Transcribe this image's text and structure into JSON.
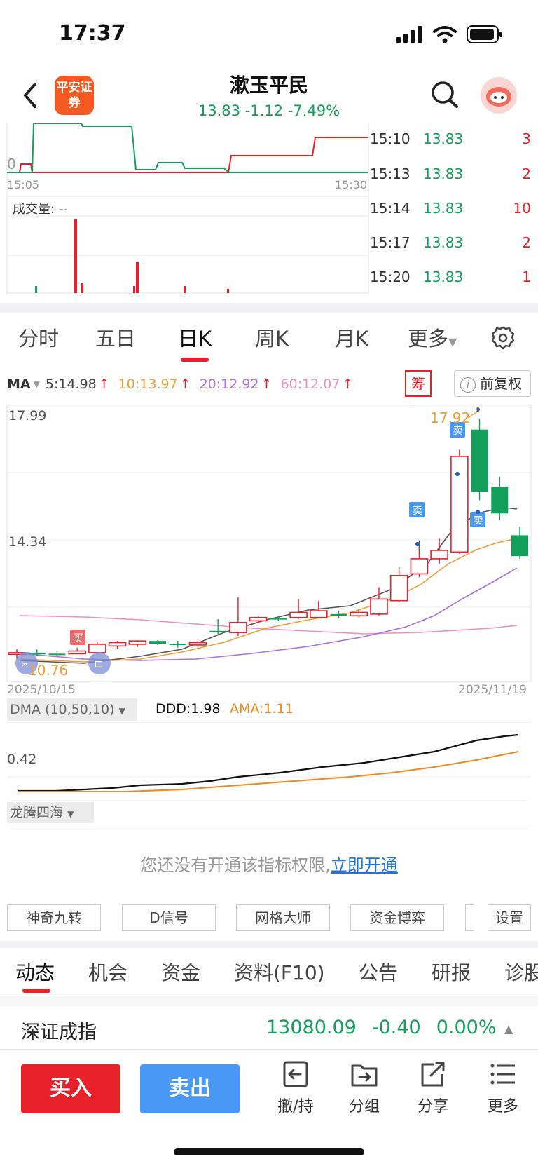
{
  "status": {
    "time": "17:37"
  },
  "header": {
    "broker_logo": "平安证券",
    "stock_name": "漱玉平民",
    "quote": "13.83 -1.12 -7.49%",
    "icons": {
      "back": "back-arrow-icon",
      "search": "search-icon",
      "avatar": "assistant-avatar-icon"
    }
  },
  "intraday": {
    "zero_label": "0",
    "time_start": "15:05",
    "time_end": "15:30",
    "volume_label": "成交量: --",
    "ticks": [
      {
        "time": "15:10",
        "price": "13.83",
        "vol": "3"
      },
      {
        "time": "15:13",
        "price": "13.83",
        "vol": "2"
      },
      {
        "time": "15:14",
        "price": "13.83",
        "vol": "10"
      },
      {
        "time": "15:17",
        "price": "13.83",
        "vol": "2"
      },
      {
        "time": "15:20",
        "price": "13.83",
        "vol": "1"
      }
    ]
  },
  "period_tabs": [
    "分时",
    "五日",
    "日K",
    "周K",
    "月K",
    "更多"
  ],
  "active_period": "日K",
  "ma": {
    "label": "MA",
    "ma5": "5:14.98",
    "ma10": "10:13.97",
    "ma20": "20:12.92",
    "ma60": "60:12.07",
    "chou_label": "筹",
    "fuquan_label": "前复权"
  },
  "kline": {
    "y_high": "17.99",
    "y_mid": "14.34",
    "peak_label": "17.92",
    "low_label": "10.76",
    "date_start": "2025/10/15",
    "date_end": "2025/11/19",
    "buy_marker": "买",
    "sell_marker": "卖"
  },
  "chart_data": {
    "type": "candlestick",
    "x_range": [
      "2025/10/15",
      "2025/11/19"
    ],
    "ylim": [
      10.76,
      17.99
    ],
    "series": [
      {
        "name": "5",
        "last": 14.98
      },
      {
        "name": "10",
        "last": 13.97
      },
      {
        "name": "20",
        "last": 12.92
      },
      {
        "name": "60",
        "last": 12.07
      }
    ],
    "candles": [
      {
        "o": 10.9,
        "h": 11.05,
        "l": 10.76,
        "c": 10.95,
        "up": true
      },
      {
        "o": 10.95,
        "h": 11.05,
        "l": 10.85,
        "c": 10.9,
        "up": false
      },
      {
        "o": 10.9,
        "h": 11.0,
        "l": 10.84,
        "c": 10.92,
        "up": false
      },
      {
        "o": 10.92,
        "h": 11.1,
        "l": 10.9,
        "c": 11.0,
        "up": true
      },
      {
        "o": 10.95,
        "h": 11.25,
        "l": 10.9,
        "c": 11.2,
        "up": true
      },
      {
        "o": 11.15,
        "h": 11.3,
        "l": 11.05,
        "c": 11.25,
        "up": true
      },
      {
        "o": 11.2,
        "h": 11.32,
        "l": 11.12,
        "c": 11.3,
        "up": true
      },
      {
        "o": 11.3,
        "h": 11.32,
        "l": 11.18,
        "c": 11.22,
        "up": false
      },
      {
        "o": 11.22,
        "h": 11.3,
        "l": 11.1,
        "c": 11.18,
        "up": false
      },
      {
        "o": 11.18,
        "h": 11.3,
        "l": 11.1,
        "c": 11.25,
        "up": true
      },
      {
        "o": 11.6,
        "h": 11.95,
        "l": 11.5,
        "c": 11.6,
        "up": false
      },
      {
        "o": 11.55,
        "h": 12.6,
        "l": 11.45,
        "c": 11.85,
        "up": true
      },
      {
        "o": 11.9,
        "h": 12.05,
        "l": 11.85,
        "c": 12.0,
        "up": true
      },
      {
        "o": 11.98,
        "h": 12.05,
        "l": 11.9,
        "c": 11.95,
        "up": false
      },
      {
        "o": 12.0,
        "h": 12.55,
        "l": 11.95,
        "c": 12.15,
        "up": true
      },
      {
        "o": 12.0,
        "h": 12.5,
        "l": 11.98,
        "c": 12.2,
        "up": true
      },
      {
        "o": 12.1,
        "h": 12.2,
        "l": 11.98,
        "c": 12.05,
        "up": false
      },
      {
        "o": 12.05,
        "h": 12.25,
        "l": 12.0,
        "c": 12.15,
        "up": true
      },
      {
        "o": 12.1,
        "h": 12.9,
        "l": 12.05,
        "c": 12.55,
        "up": true
      },
      {
        "o": 12.5,
        "h": 13.5,
        "l": 12.45,
        "c": 13.25,
        "up": true
      },
      {
        "o": 13.3,
        "h": 14.3,
        "l": 13.2,
        "c": 13.75,
        "up": true
      },
      {
        "o": 13.75,
        "h": 14.35,
        "l": 13.6,
        "c": 14.0,
        "up": true
      },
      {
        "o": 13.95,
        "h": 17.0,
        "l": 13.9,
        "c": 16.8,
        "up": true
      },
      {
        "o": 17.6,
        "h": 17.92,
        "l": 15.5,
        "c": 15.75,
        "up": false
      },
      {
        "o": 15.9,
        "h": 16.2,
        "l": 14.9,
        "c": 15.1,
        "up": false
      },
      {
        "o": 14.45,
        "h": 14.7,
        "l": 13.75,
        "c": 13.83,
        "up": false
      }
    ]
  },
  "dma": {
    "title": "DMA (10,50,10)",
    "ddd": "DDD:1.98",
    "ama": "AMA:1.11",
    "y_label": "0.42"
  },
  "longteng": {
    "title": "龙腾四海",
    "perm_text": "您还没有开通该指标权限,",
    "perm_link": "立即开通"
  },
  "tools": [
    "神奇九转",
    "D信号",
    "网格大师",
    "资金博弈",
    "设置"
  ],
  "news_tabs": [
    "动态",
    "机会",
    "资金",
    "资料(F10)",
    "公告",
    "研报",
    "诊股"
  ],
  "index": {
    "name": "深证成指",
    "value": "13080.09",
    "change": "-0.40",
    "pct": "0.00%"
  },
  "bottom": {
    "buy": "买入",
    "sell": "卖出",
    "actions": [
      {
        "label": "撤/持",
        "icon": "cancel-hold-icon"
      },
      {
        "label": "分组",
        "icon": "folder-group-icon"
      },
      {
        "label": "分享",
        "icon": "share-icon"
      },
      {
        "label": "更多",
        "icon": "more-menu-icon"
      }
    ]
  },
  "colors": {
    "up": "#e8202a",
    "down": "#12a05c",
    "ma5": "#555555",
    "ma10": "#f0a030",
    "ma20": "#a870e0",
    "ma60": "#f090c0"
  }
}
